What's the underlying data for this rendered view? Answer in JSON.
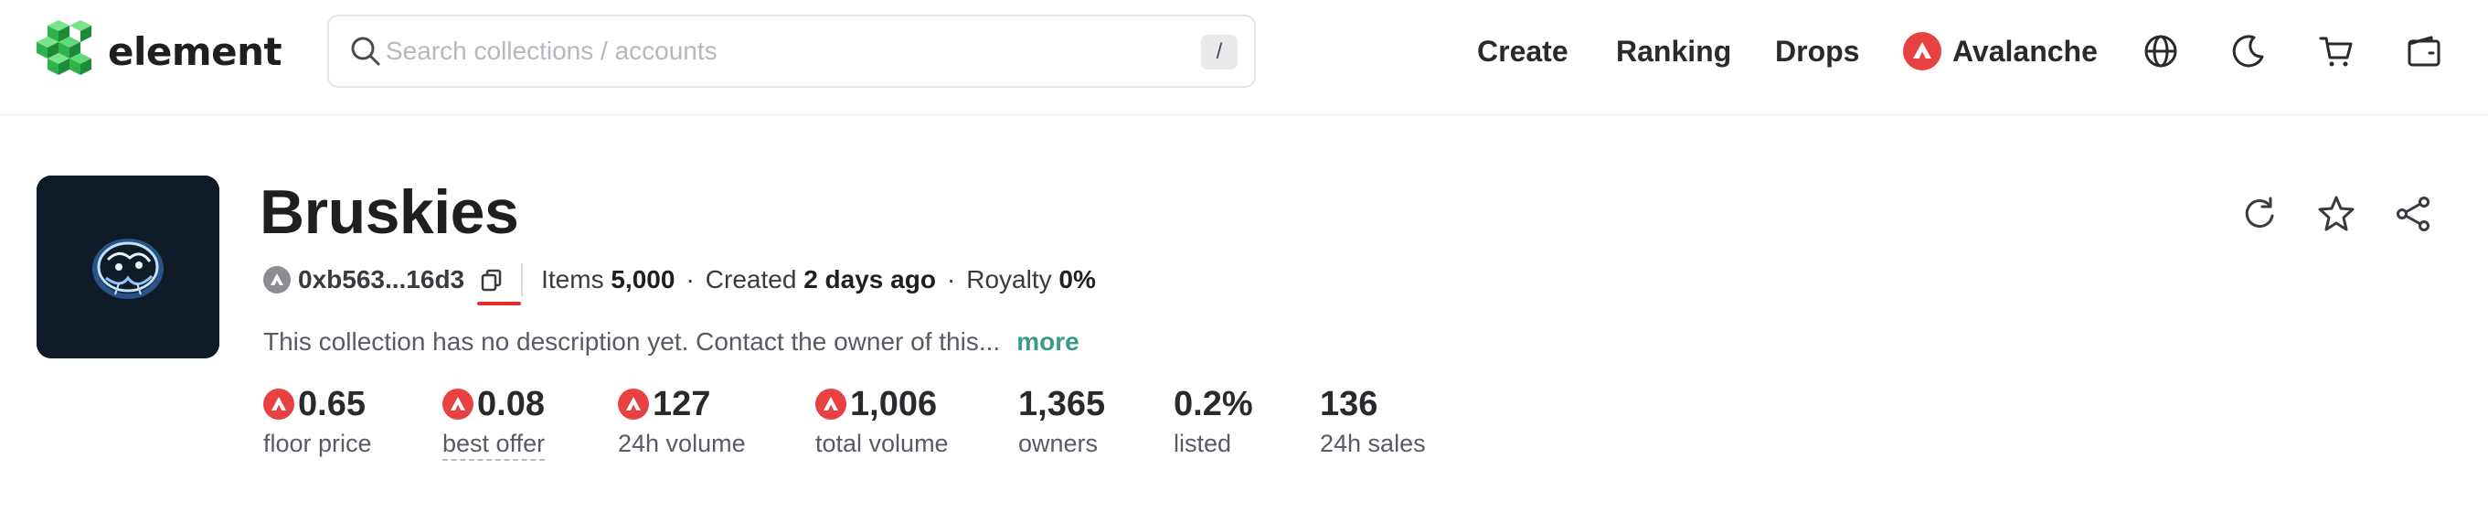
{
  "header": {
    "logo_text": "element",
    "search": {
      "placeholder": "Search collections / accounts",
      "value": "",
      "shortcut": "/"
    },
    "nav": {
      "create": "Create",
      "ranking": "Ranking",
      "drops": "Drops"
    },
    "chain": {
      "label": "Avalanche",
      "icon": "avalanche-icon",
      "color": "#e84142"
    },
    "icons": [
      "globe-icon",
      "moon-icon",
      "cart-icon",
      "wallet-icon"
    ]
  },
  "collection": {
    "name": "Bruskies",
    "address": "0xb563...16d3",
    "items_label": "Items",
    "items_value": "5,000",
    "created_label": "Created",
    "created_value": "2 days ago",
    "royalty_label": "Royalty",
    "royalty_value": "0%",
    "description": "This collection has no description yet. Contact the owner of this...",
    "more": "more",
    "actions": [
      "refresh-icon",
      "star-icon",
      "share-icon"
    ]
  },
  "stats": [
    {
      "value": "0.65",
      "label": "floor price",
      "currency": true
    },
    {
      "value": "0.08",
      "label": "best offer",
      "currency": true
    },
    {
      "value": "127",
      "label": "24h volume",
      "currency": true
    },
    {
      "value": "1,006",
      "label": "total volume",
      "currency": true
    },
    {
      "value": "1,365",
      "label": "owners",
      "currency": false
    },
    {
      "value": "0.2%",
      "label": "listed",
      "currency": false
    },
    {
      "value": "136",
      "label": "24h sales",
      "currency": false
    }
  ],
  "colors": {
    "accent": "#3a9a84",
    "avalanche": "#e84142",
    "copy_highlight": "#e0302c"
  }
}
